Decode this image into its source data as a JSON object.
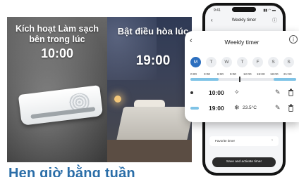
{
  "promo_left": {
    "title": "Kích hoạt Làm sạch bên trong lúc",
    "time": "10:00"
  },
  "promo_mid": {
    "title": "Bật điều hòa lúc",
    "time": "19:00"
  },
  "bottom_heading": "Hẹn giờ bằng tuần",
  "phone": {
    "status_time": "9:41",
    "status_icons": "▮▮ ◠ ▬",
    "title": "Weekly timer",
    "favorite_label": "Favorite timer",
    "save_label": "Save and activate timer"
  },
  "popup": {
    "title": "Weekly timer",
    "info_glyph": "i",
    "back_glyph": "‹",
    "days": [
      {
        "label": "M",
        "active": true
      },
      {
        "label": "T",
        "active": false
      },
      {
        "label": "W",
        "active": false
      },
      {
        "label": "T",
        "active": false
      },
      {
        "label": "F",
        "active": false
      },
      {
        "label": "S",
        "active": false
      },
      {
        "label": "S",
        "active": false
      }
    ],
    "hours": [
      "0:00",
      "3:00",
      "6:00",
      "9:00",
      "12:00",
      "15:00",
      "18:00",
      "21:00"
    ],
    "schedules": [
      {
        "time": "10:00",
        "mode_icon": "clean-sparkle-icon",
        "mode_glyph": "✧",
        "temp": ""
      },
      {
        "time": "19:00",
        "mode_icon": "cool-snowflake-icon",
        "mode_glyph": "❄",
        "temp": "23.5°C"
      }
    ],
    "colors": {
      "accent": "#2c6fbf",
      "cool_segment": "#7fc3e6"
    }
  }
}
